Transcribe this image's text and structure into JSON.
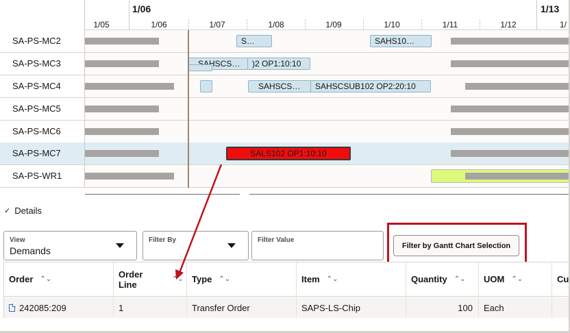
{
  "timeline": {
    "weeks": [
      "1/06",
      "1/13"
    ],
    "days": [
      "1/05",
      "1/06",
      "1/07",
      "1/08",
      "1/09",
      "1/10",
      "1/11",
      "1/12",
      "1/"
    ]
  },
  "resources": [
    {
      "label": "SA-PS-MC2",
      "tasks": [
        "S…",
        "SAHS10…"
      ]
    },
    {
      "label": "SA-PS-MC3",
      "tasks": [
        "SAHSCS…",
        ")2 OP1:10:10"
      ]
    },
    {
      "label": "SA-PS-MC4",
      "tasks": [
        "SAHSCS…",
        "SAHSCSUB102 OP2:20:10"
      ]
    },
    {
      "label": "SA-PS-MC5",
      "tasks": []
    },
    {
      "label": "SA-PS-MC6",
      "tasks": []
    },
    {
      "label": "SA-PS-MC7",
      "tasks": [
        "SALS102 OP1:10:10"
      ]
    },
    {
      "label": "SA-PS-WR1",
      "tasks": []
    }
  ],
  "colors": {
    "selected_task": "#f20d0d",
    "task": "#d1e4ee",
    "highlight": "#c0111f",
    "lime": "#dcf97b"
  },
  "details": {
    "toggle_label": "Details",
    "view": {
      "label": "View",
      "value": "Demands"
    },
    "filter_by": {
      "label": "Filter By",
      "value": ""
    },
    "filter_value": {
      "label": "Filter Value",
      "value": ""
    },
    "filter_button_label": "Filter by Gantt Chart Selection"
  },
  "table": {
    "columns": [
      {
        "label": "Order"
      },
      {
        "label": "Order Line"
      },
      {
        "label": "Type"
      },
      {
        "label": "Item"
      },
      {
        "label": "Quantity"
      },
      {
        "label": "UOM"
      },
      {
        "label": "Cu"
      }
    ],
    "rows": [
      {
        "order": "242085:209",
        "order_line": "1",
        "type": "Transfer Order",
        "item": "SAPS-LS-Chip",
        "quantity": "100",
        "uom": "Each",
        "cu": ""
      }
    ]
  },
  "icons": {
    "sort": "sort-arrows-icon",
    "chevron": "chevron-down-icon",
    "document": "document-icon"
  }
}
